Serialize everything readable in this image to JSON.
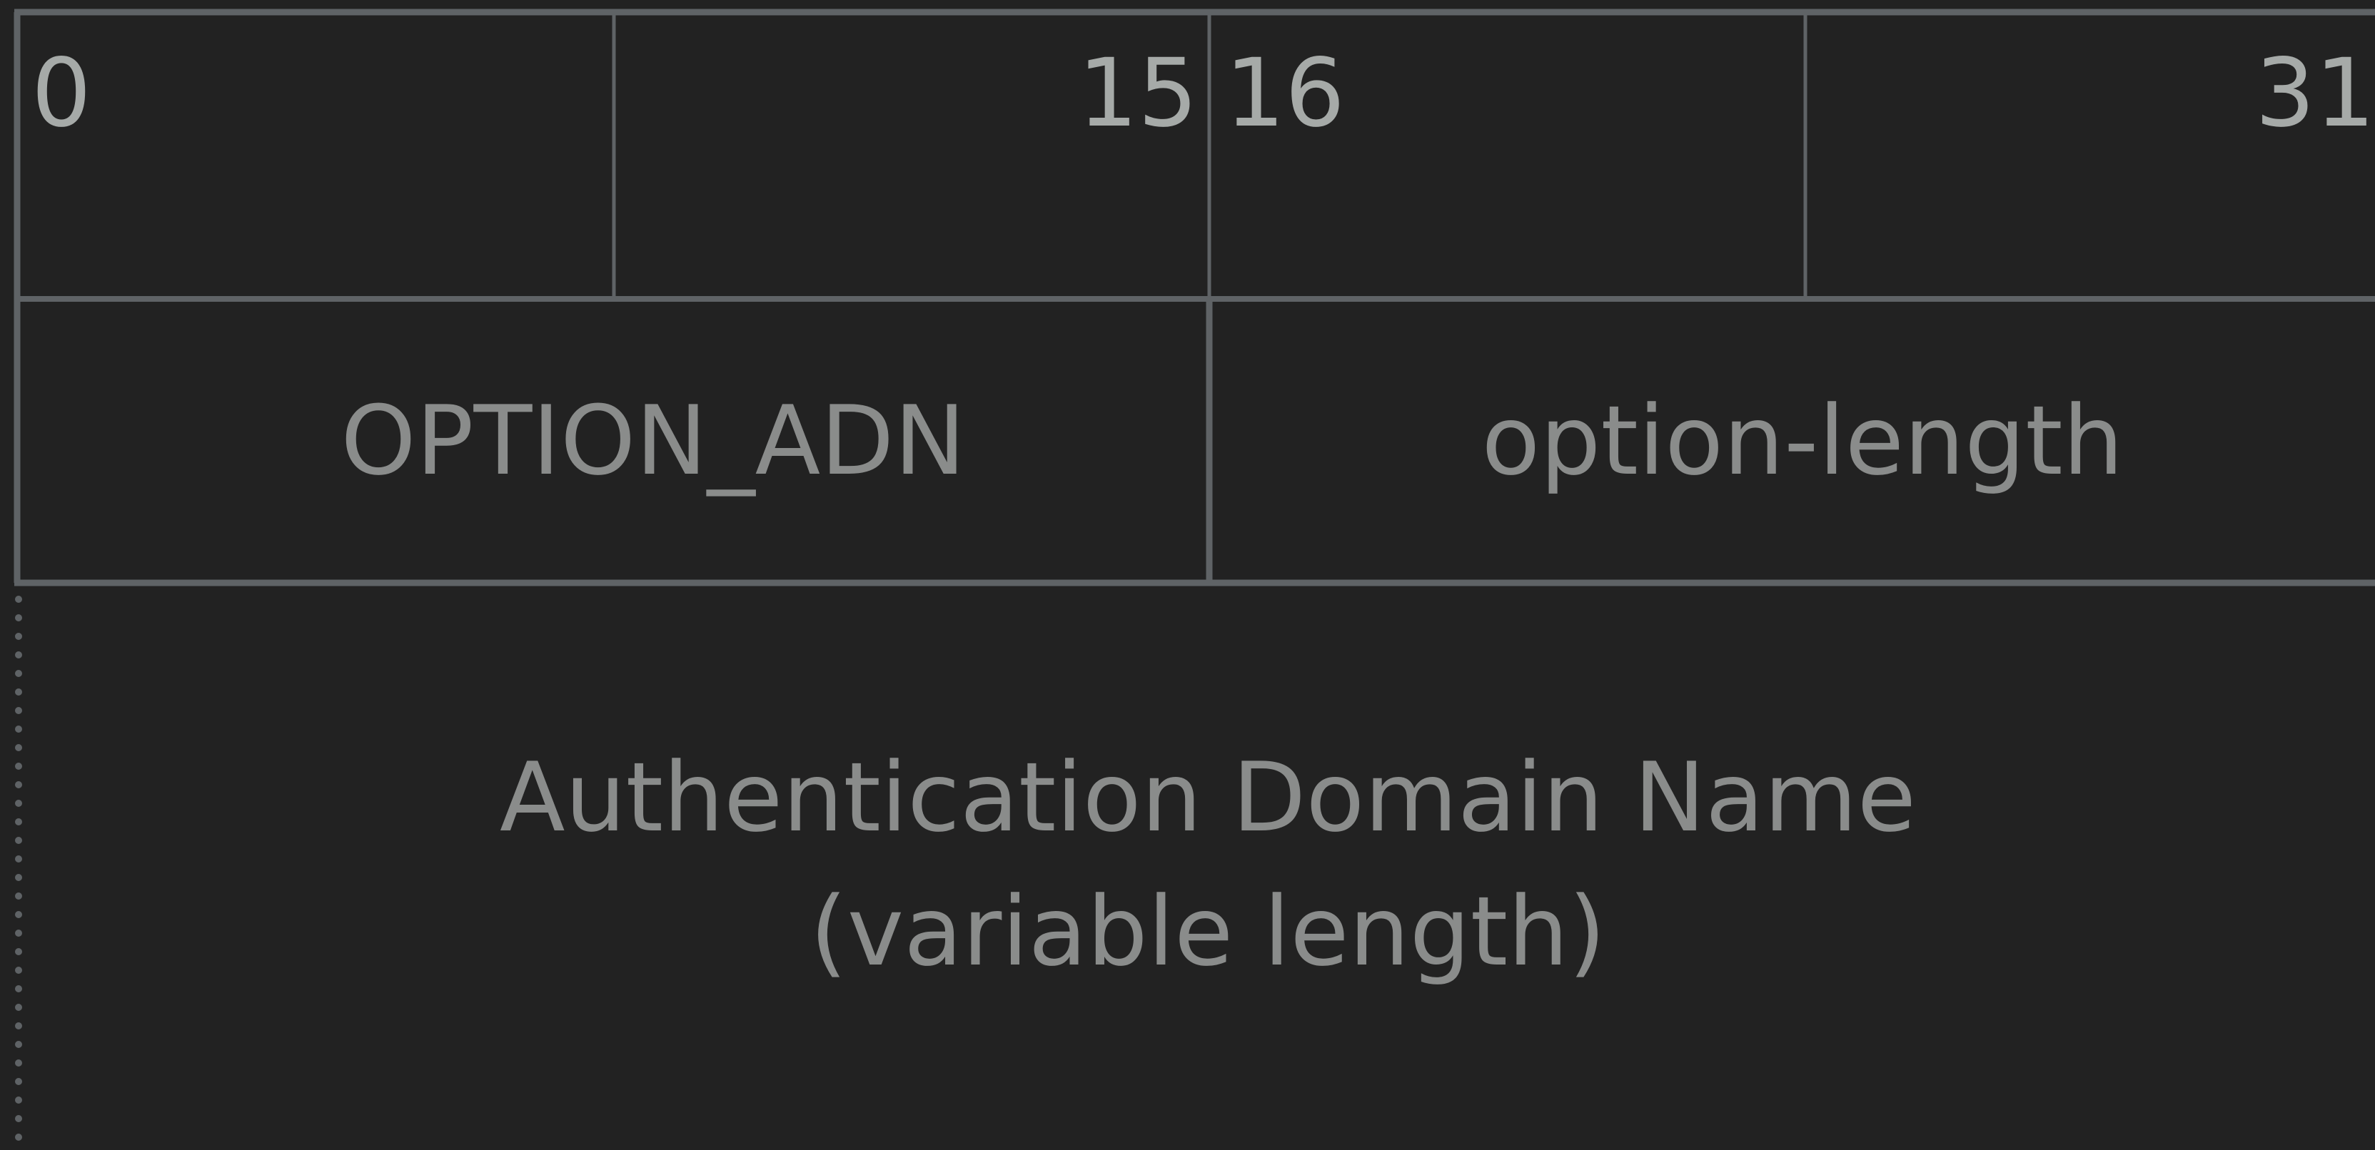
{
  "diagram": {
    "bit_labels": {
      "start_0": "0",
      "end_0": "15",
      "start_1": "16",
      "end_1": "31"
    },
    "row1": {
      "left_field": "OPTION_ADN",
      "right_field": "option-length"
    },
    "row2": {
      "line1": "Authentication Domain Name",
      "line2": "(variable length)"
    },
    "colors": {
      "background": "#222222",
      "border": "#5f6366",
      "bit_text": "#a6aaa8",
      "field_text": "#8a8c8b"
    }
  }
}
